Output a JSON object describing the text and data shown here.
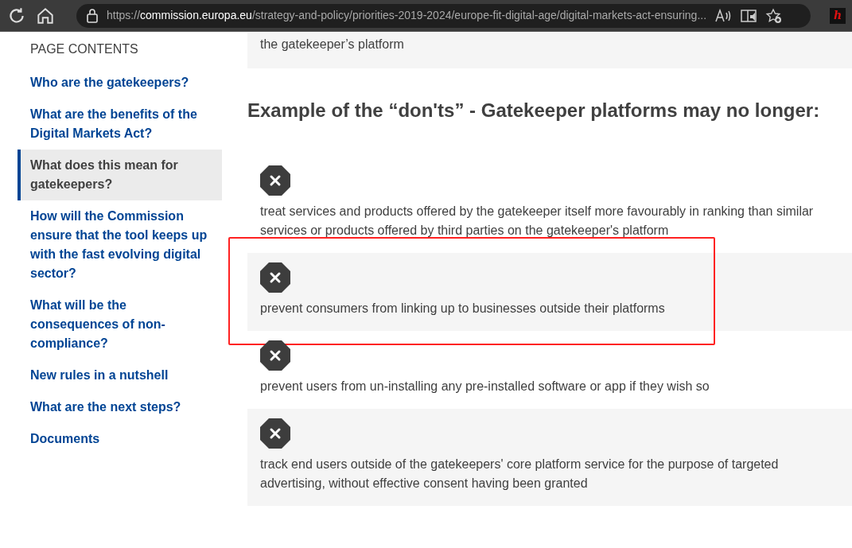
{
  "browser": {
    "url": {
      "scheme": "https://",
      "host": "commission.europa.eu",
      "path": "/strategy-and-policy/priorities-2019-2024/europe-fit-digital-age/digital-markets-act-ensuring..."
    },
    "extension_label": "h"
  },
  "sidebar": {
    "title": "PAGE CONTENTS",
    "items": [
      {
        "label": "Who are the gatekeepers?",
        "selected": false
      },
      {
        "label": "What are the benefits of the Digital Markets Act?",
        "selected": false
      },
      {
        "label": "What does this mean for gatekeepers?",
        "selected": true
      },
      {
        "label": "How will the Commission ensure that the tool keeps up with the fast evolving digital sector?",
        "selected": false
      },
      {
        "label": "What will be the consequences of non-compliance?",
        "selected": false
      },
      {
        "label": "New rules in a nutshell",
        "selected": false
      },
      {
        "label": "What are the next steps?",
        "selected": false
      },
      {
        "label": "Documents",
        "selected": false
      }
    ]
  },
  "content": {
    "top_fragment": "the gatekeeper’s platform",
    "heading": "Example of the “don'ts” - Gatekeeper platforms may no longer:",
    "items": [
      {
        "text": "treat services and products offered by the gatekeeper itself more favourably in ranking than similar services or products offered by third parties on the gatekeeper's platform",
        "highlighted": false
      },
      {
        "text": "prevent consumers from linking up to businesses outside their platforms",
        "highlighted": true
      },
      {
        "text": "prevent users from un-installing any pre-installed software or app if they wish so",
        "highlighted": false
      },
      {
        "text": "track end users outside of the gatekeepers' core platform service for the purpose of targeted advertising, without effective consent having been granted",
        "highlighted": false
      }
    ]
  }
}
